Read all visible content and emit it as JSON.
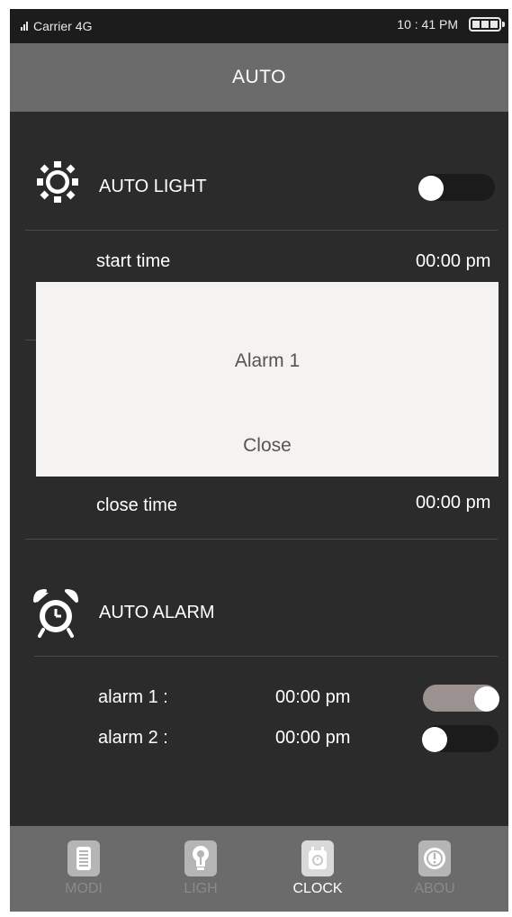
{
  "status_bar": {
    "carrier": "Carrier",
    "network": "4G",
    "time": "10 : 41 PM"
  },
  "header": {
    "title": "AUTO"
  },
  "auto_light": {
    "label": "AUTO LIGHT",
    "toggle_on": false,
    "start_label": "start time",
    "start_value": "00:00 pm",
    "close_label": "close time",
    "close_value": "00:00 pm"
  },
  "dialog": {
    "title": "Alarm 1",
    "close_label": "Close"
  },
  "auto_alarm": {
    "label": "AUTO ALARM",
    "alarms": [
      {
        "label": "alarm 1 :",
        "time": "00:00 pm",
        "enabled": true
      },
      {
        "label": "alarm 2 :",
        "time": "00:00 pm",
        "enabled": false
      }
    ]
  },
  "tabs": [
    {
      "label": "MODI",
      "icon": "phone-icon",
      "active": false
    },
    {
      "label": "LIGH",
      "icon": "bulb-icon",
      "active": false
    },
    {
      "label": "CLOCK",
      "icon": "clock-icon",
      "active": true
    },
    {
      "label": "ABOU",
      "icon": "info-icon",
      "active": false
    }
  ],
  "colors": {
    "background": "#2b2b2b",
    "header": "#6b6b6b",
    "toggle_on": "#9a9190",
    "dialog": "#f5f3f1"
  }
}
